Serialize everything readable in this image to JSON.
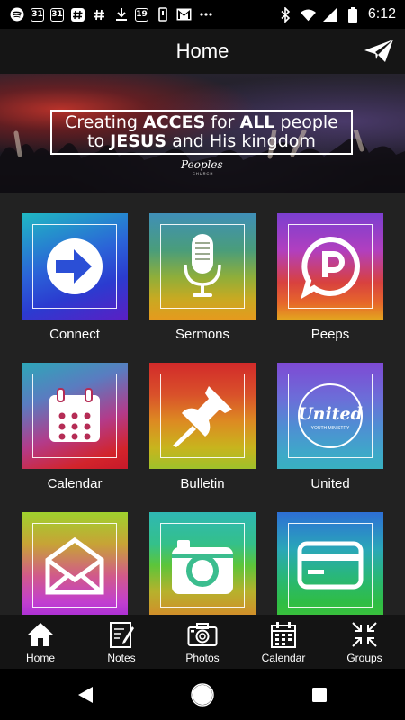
{
  "status_bar": {
    "time": "6:12",
    "icons": [
      "spotify-icon",
      "calendar-31-icon",
      "calendar-31-icon",
      "slack-icon",
      "slack-icon",
      "download-icon",
      "photo-icon",
      "card-icon",
      "gmail-icon",
      "more-dots-icon",
      "bluetooth-icon",
      "wifi-icon",
      "signal-icon",
      "battery-icon"
    ],
    "calendar_day": "31",
    "photo_letter": "19"
  },
  "app_bar": {
    "title": "Home"
  },
  "banner": {
    "line1_pre": "Creating ",
    "line1_bold1": "ACCES",
    "line1_mid": " for ",
    "line1_bold2": "ALL",
    "line1_post": " people",
    "line2_pre": "to ",
    "line2_bold1": "JESUS",
    "line2_mid": " and His kingdom",
    "logo": "Peoples",
    "logo_sub": "CHURCH"
  },
  "tiles": [
    {
      "label": "Connect",
      "icon": "arrow-circle-icon"
    },
    {
      "label": "Sermons",
      "icon": "microphone-icon"
    },
    {
      "label": "Peeps",
      "icon": "chat-bubble-icon"
    },
    {
      "label": "Calendar",
      "icon": "calendar-icon"
    },
    {
      "label": "Bulletin",
      "icon": "pushpin-icon"
    },
    {
      "label": "United",
      "icon": "united-logo-icon",
      "logo_text": "United",
      "logo_sub": "YOUTH MINISTRY"
    },
    {
      "label": "",
      "icon": "envelope-icon"
    },
    {
      "label": "",
      "icon": "camera-icon"
    },
    {
      "label": "",
      "icon": "credit-card-icon"
    }
  ],
  "bottom_nav": [
    {
      "label": "Home",
      "icon": "home-icon"
    },
    {
      "label": "Notes",
      "icon": "notes-icon"
    },
    {
      "label": "Photos",
      "icon": "camera-icon"
    },
    {
      "label": "Calendar",
      "icon": "calendar-icon"
    },
    {
      "label": "Groups",
      "icon": "groups-icon"
    }
  ],
  "colors": {
    "background": "#222222",
    "app_bar": "#151515",
    "nav_bar": "#141414",
    "text": "#ffffff"
  }
}
